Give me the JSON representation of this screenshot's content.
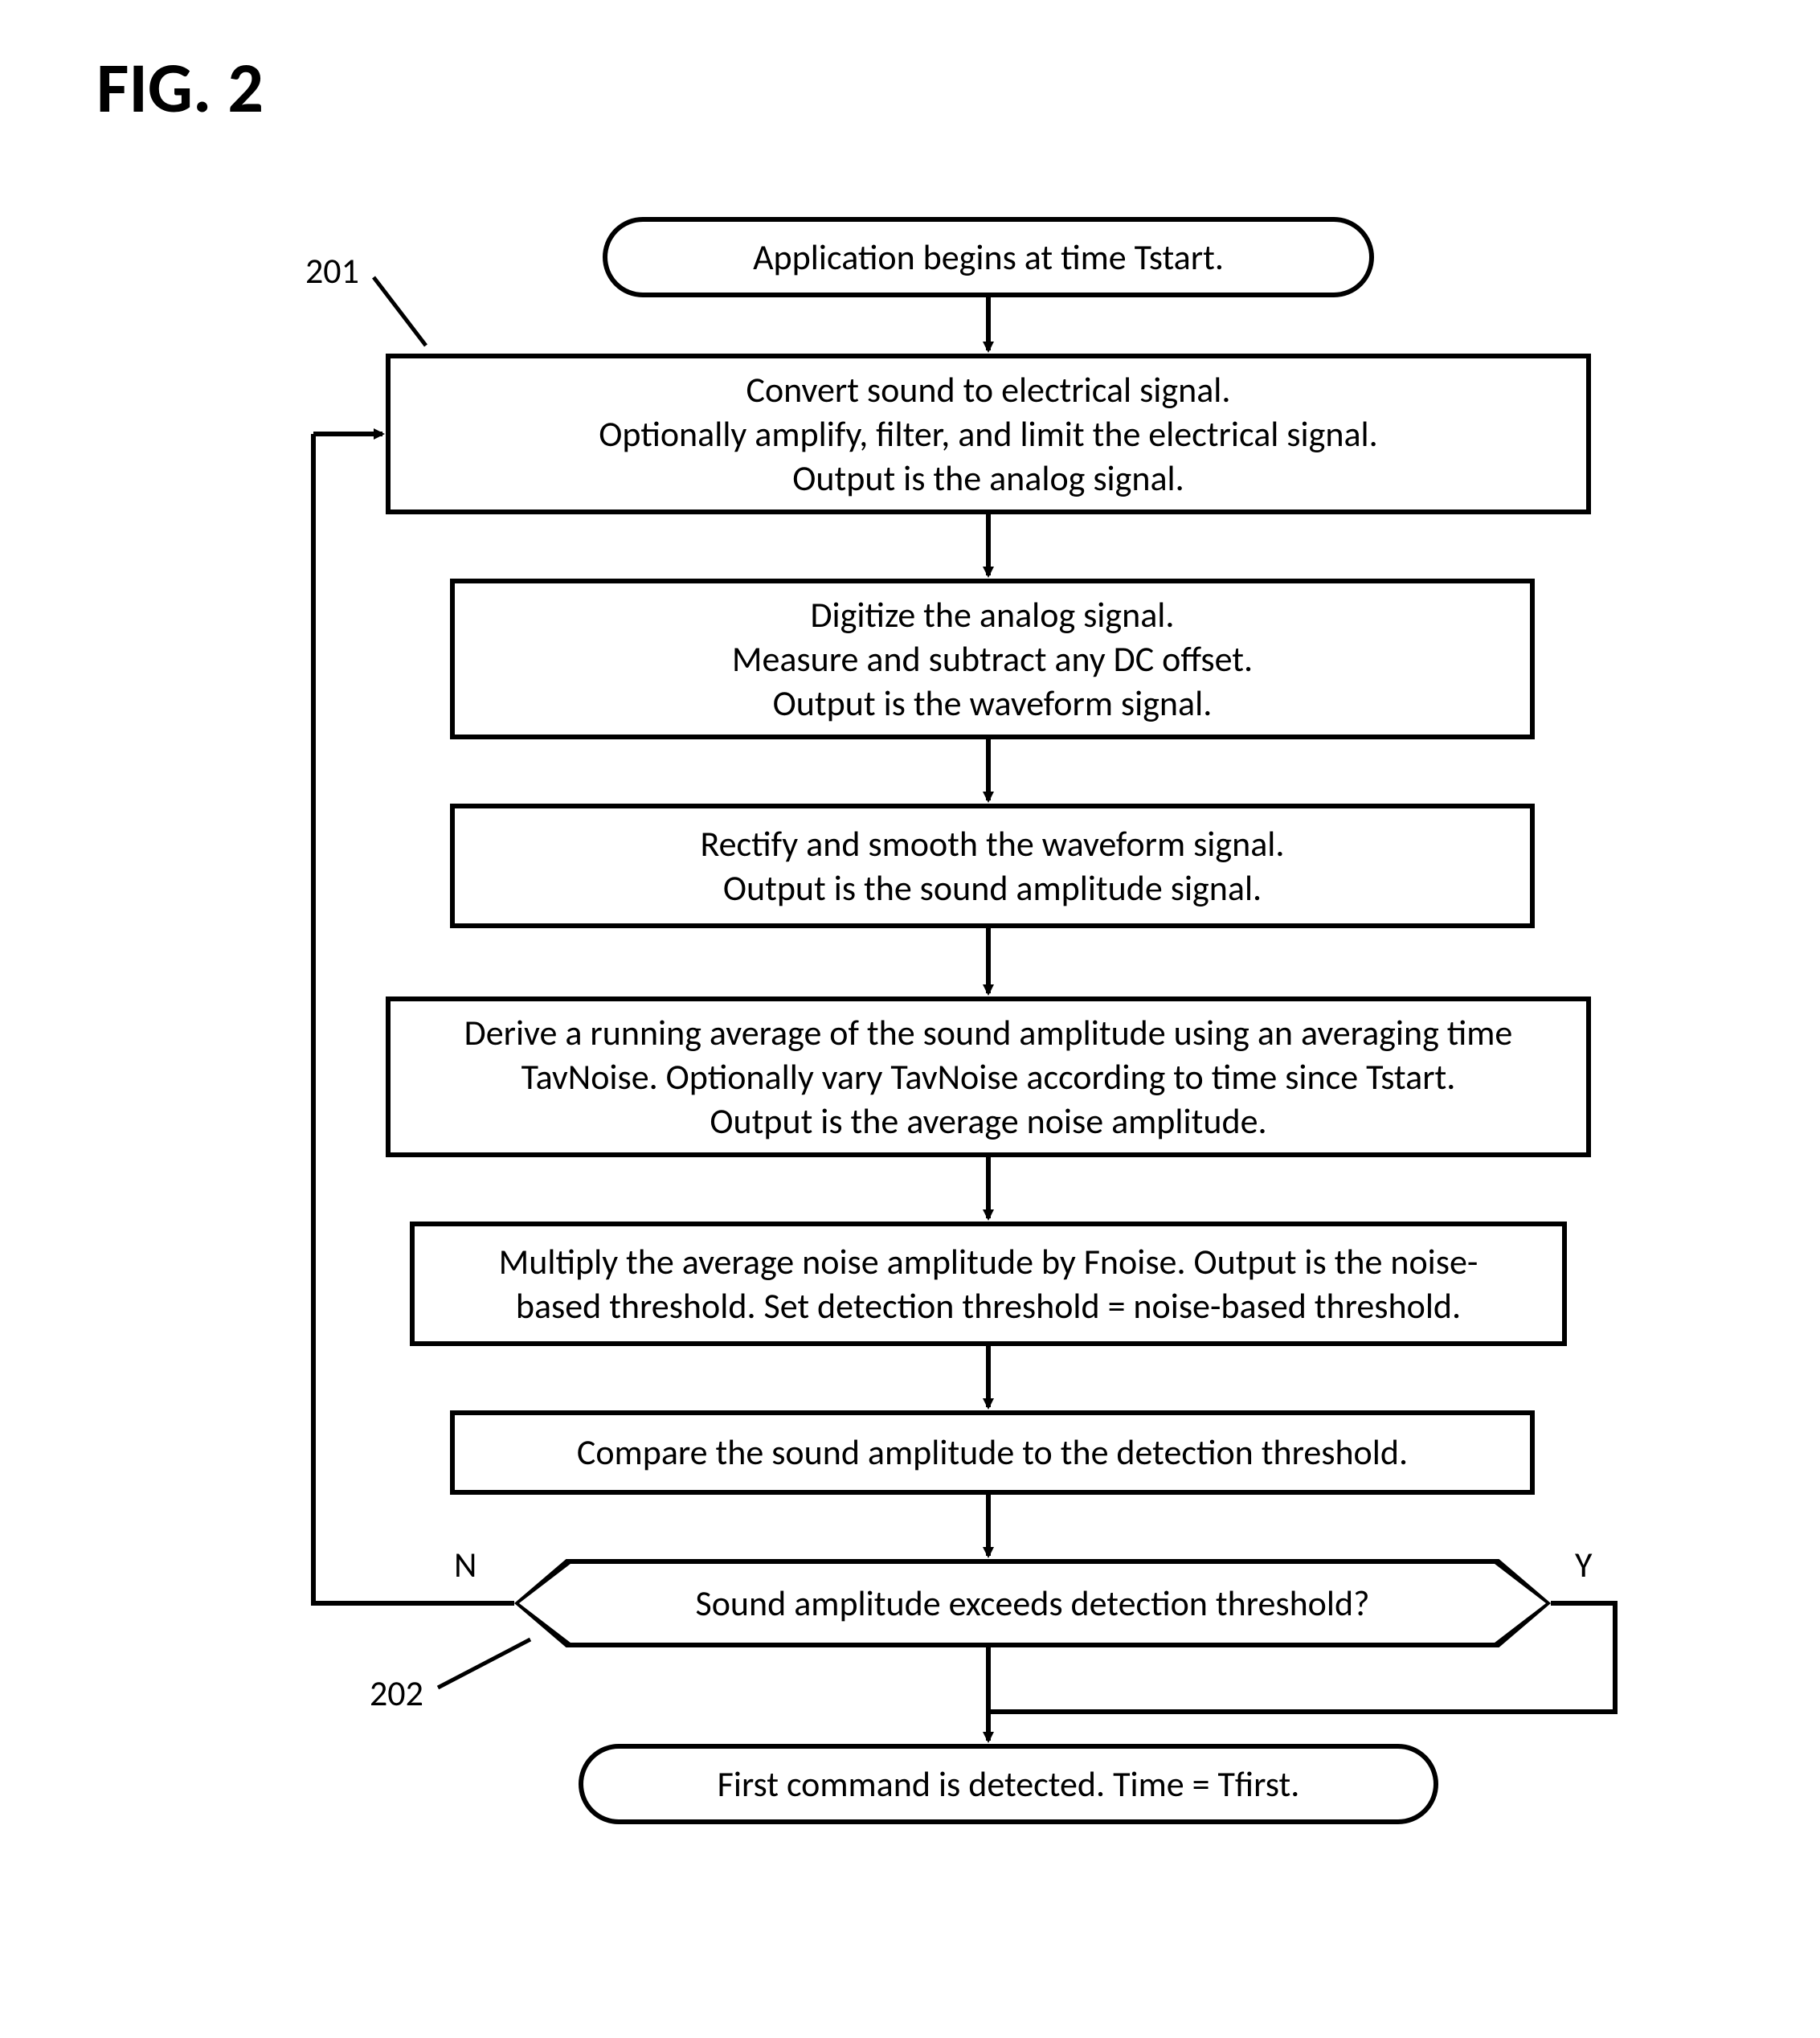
{
  "figure_label": "FIG. 2",
  "ref_201": "201",
  "ref_202": "202",
  "decision_N": "N",
  "decision_Y": "Y",
  "terminator_start": "Application begins at time Tstart.",
  "process1_line1": "Convert sound to electrical signal.",
  "process1_line2": "Optionally amplify, filter, and limit the electrical signal.",
  "process1_line3": "Output is the analog signal.",
  "process2_line1": "Digitize the analog signal.",
  "process2_line2": "Measure and subtract any DC offset.",
  "process2_line3": "Output is the waveform signal.",
  "process3_line1": "Rectify and smooth the waveform signal.",
  "process3_line2": "Output is the sound amplitude signal.",
  "process4_line1": "Derive a running average of the sound amplitude using an averaging time",
  "process4_line2": "TavNoise.  Optionally vary TavNoise according to time since Tstart.",
  "process4_line3": "Output is the average noise amplitude.",
  "process5_line1": "Multiply the average noise amplitude by Fnoise.  Output is the noise-",
  "process5_line2": "based threshold.  Set detection threshold = noise-based threshold.",
  "process6_line1": "Compare the sound amplitude to the detection threshold.",
  "decision_text": "Sound amplitude exceeds detection threshold?",
  "terminator_end": "First command is detected.  Time = Tfirst."
}
